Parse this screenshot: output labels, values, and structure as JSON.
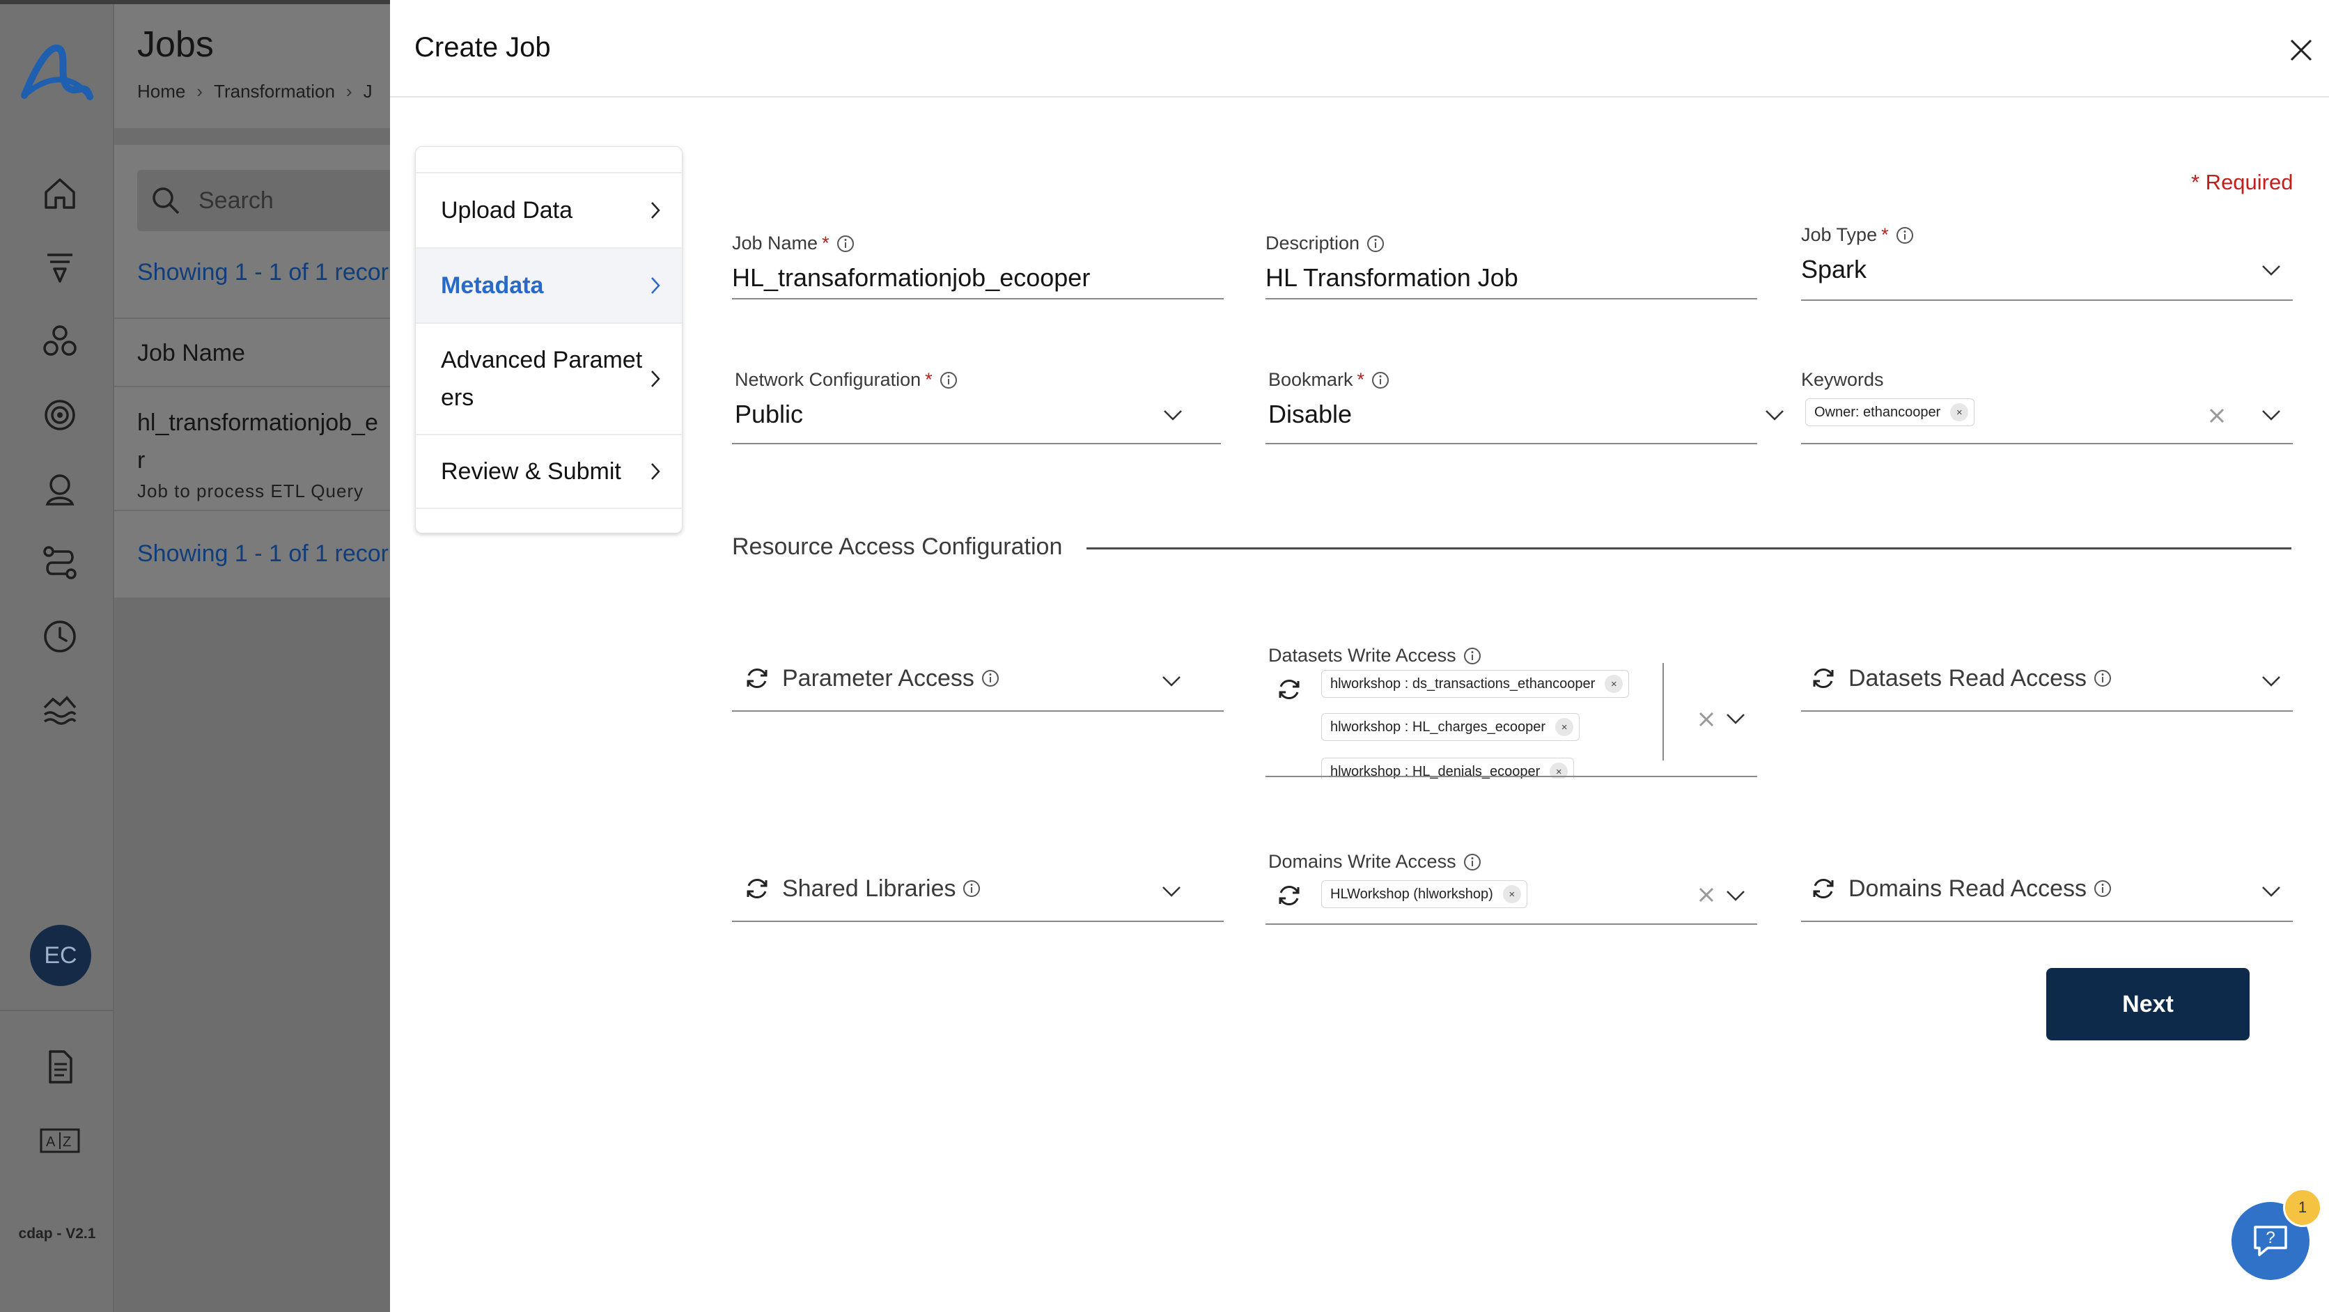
{
  "app": {
    "version_label": "cdap - V2.1",
    "user_initials": "EC",
    "nav_icons": [
      "home-icon",
      "filter-icon",
      "cluster-icon",
      "target-icon",
      "user-icon",
      "workflow-icon",
      "clock-icon",
      "datalake-icon",
      "document-icon",
      "translate-icon"
    ]
  },
  "background_page": {
    "title": "Jobs",
    "breadcrumb": [
      "Home",
      "Transformation",
      "J"
    ],
    "search_placeholder": "Search",
    "showing_top": "Showing 1 - 1 of 1 recor",
    "column_header": "Job Name",
    "job_name": "hl_transformationjob_ecoope r",
    "job_name_display": "hl_transformationjob_e r",
    "job_description": "Job to process ETL Query",
    "showing_bottom": "Showing 1 - 1 of 1 recor"
  },
  "modal": {
    "title": "Create Job",
    "required_note": "* Required",
    "steps": [
      {
        "label": "Upload Data",
        "active": false
      },
      {
        "label": "Metadata",
        "active": true
      },
      {
        "label": "Advanced Parameters",
        "display": "Advanced Paramet ers",
        "active": false
      },
      {
        "label": "Review & Submit",
        "active": false
      }
    ],
    "fields": {
      "job_name": {
        "label": "Job Name",
        "required": true,
        "value": "HL_transaformationjob_ecooper"
      },
      "description": {
        "label": "Description",
        "value": "HL Transformation Job"
      },
      "job_type": {
        "label": "Job Type",
        "required": true,
        "value": "Spark"
      },
      "network_configuration": {
        "label": "Network Configuration",
        "required": true,
        "value": "Public"
      },
      "bookmark": {
        "label": "Bookmark",
        "required": true,
        "value": "Disable"
      },
      "keywords": {
        "label": "Keywords",
        "chips": [
          "Owner: ethancooper"
        ]
      }
    },
    "resource_section_title": "Resource Access Configuration",
    "resource_access": {
      "parameter_access": {
        "label": "Parameter Access"
      },
      "datasets_write_access": {
        "label": "Datasets Write Access",
        "chips": [
          "hlworkshop : ds_transactions_ethancooper",
          "hlworkshop : HL_charges_ecooper",
          "hlworkshop : HL_denials_ecooper"
        ]
      },
      "datasets_read_access": {
        "label": "Datasets Read Access"
      },
      "shared_libraries": {
        "label": "Shared Libraries"
      },
      "domains_write_access": {
        "label": "Domains Write Access",
        "chips": [
          "HLWorkshop (hlworkshop)"
        ]
      },
      "domains_read_access": {
        "label": "Domains Read Access"
      }
    },
    "next_label": "Next"
  },
  "help": {
    "badge_count": "1"
  },
  "colors": {
    "sidebar_bg": "#727272",
    "primary_button": "#0e2a4a",
    "active_step_text": "#2a69c6",
    "required": "#c21e1e",
    "help_button": "#2f72c8",
    "badge": "#f5c242",
    "avatar": "#152a46"
  }
}
